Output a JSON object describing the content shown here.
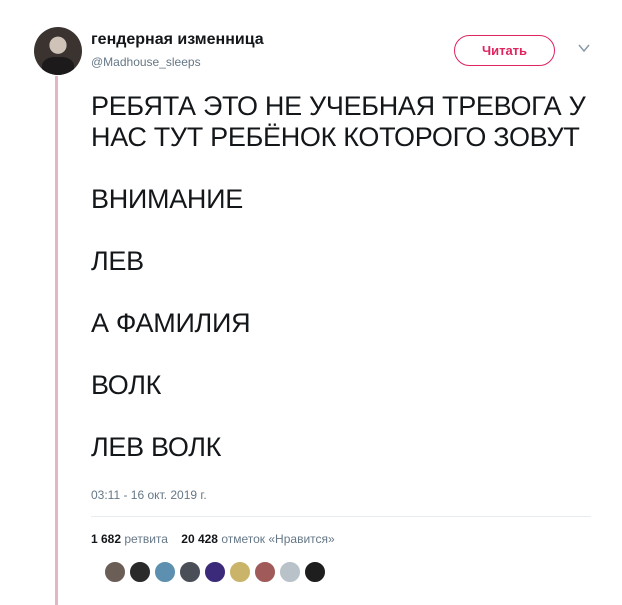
{
  "tweet": {
    "author": {
      "display_name": "гендерная изменница",
      "handle": "@Madhouse_sleeps"
    },
    "follow_label": "Читать",
    "text_lines": [
      [
        "РЕБЯТА ЭТО НЕ УЧЕБНАЯ ТРЕВОГА У",
        "НАС ТУТ РЕБЁНОК КОТОРОГО ЗОВУТ"
      ],
      [
        "ВНИМАНИЕ"
      ],
      [
        "ЛЕВ"
      ],
      [
        "А ФАМИЛИЯ"
      ],
      [
        "ВОЛК"
      ],
      [
        "ЛЕВ ВОЛК"
      ]
    ],
    "timestamp": "03:11 - 16 окт. 2019 г.",
    "stats": {
      "retweets_count": "1 682",
      "retweets_label": "ретвита",
      "likes_count": "20 428",
      "likes_label": "отметок «Нравится»"
    },
    "liker_colors": [
      "#6b5e57",
      "#2a2a2a",
      "#5d8fb0",
      "#4a4f57",
      "#3b2a7a",
      "#c9b46a",
      "#a05a5a",
      "#b9c2c8",
      "#1e1e1e"
    ]
  },
  "colors": {
    "accent": "#e0245e",
    "thread_line": "#e2b6c2",
    "secondary_text": "#657786"
  },
  "icons": {
    "more": "chevron-down-icon"
  }
}
